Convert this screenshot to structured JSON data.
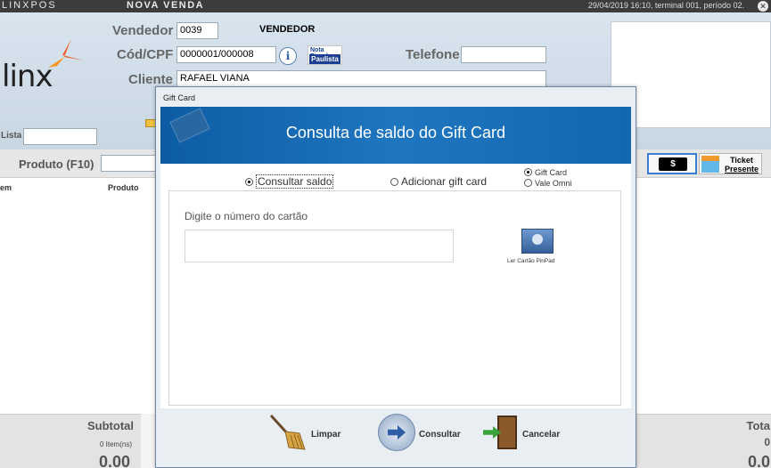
{
  "topbar": {
    "app": "LINXPOS",
    "title": "NOVA VENDA",
    "info": "29/04/2019 16:10, terminal 001, período 02."
  },
  "header": {
    "logo": "linx",
    "vendedor_label": "Vendedor",
    "vendedor_code": "0039",
    "vendedor_name": "VENDEDOR",
    "cpf_label": "Cód/CPF",
    "cpf_value": "0000001/000008",
    "nfp_top": "Nota Fiscal",
    "nfp_bottom": "Paulista",
    "telefone_label": "Telefone",
    "telefone_value": "",
    "cliente_label": "Cliente",
    "cliente_value": "RAFAEL VIANA",
    "lista_label": "Lista",
    "lista_value": ""
  },
  "produto": {
    "label": "Produto (F10)",
    "value": ""
  },
  "grid": {
    "col_item": "em",
    "col_produto": "Produto"
  },
  "toolbar": {
    "money_symbol": "$",
    "ticket_label_1": "Ticket",
    "ticket_label_2": "Presente"
  },
  "footer": {
    "subtotal_label": "Subtotal",
    "items": "0 Item(ns)",
    "subtotal_value": "0.00",
    "total_label": "Tota",
    "total_count": "0",
    "total_value": "0.0"
  },
  "dialog": {
    "title": "Gift Card",
    "heading": "Consulta de saldo do Gift Card",
    "option_consultar": "Consultar saldo",
    "option_adicionar": "Adicionar gift card",
    "option_giftcard": "Gift Card",
    "option_valeomni": "Vale Omni",
    "card_label": "Digite o número do cartão",
    "card_value": "",
    "pinpad_label": "Ler Cartão PinPad",
    "btn_limpar": "Limpar",
    "btn_consultar": "Consultar",
    "btn_cancelar": "Cancelar"
  }
}
